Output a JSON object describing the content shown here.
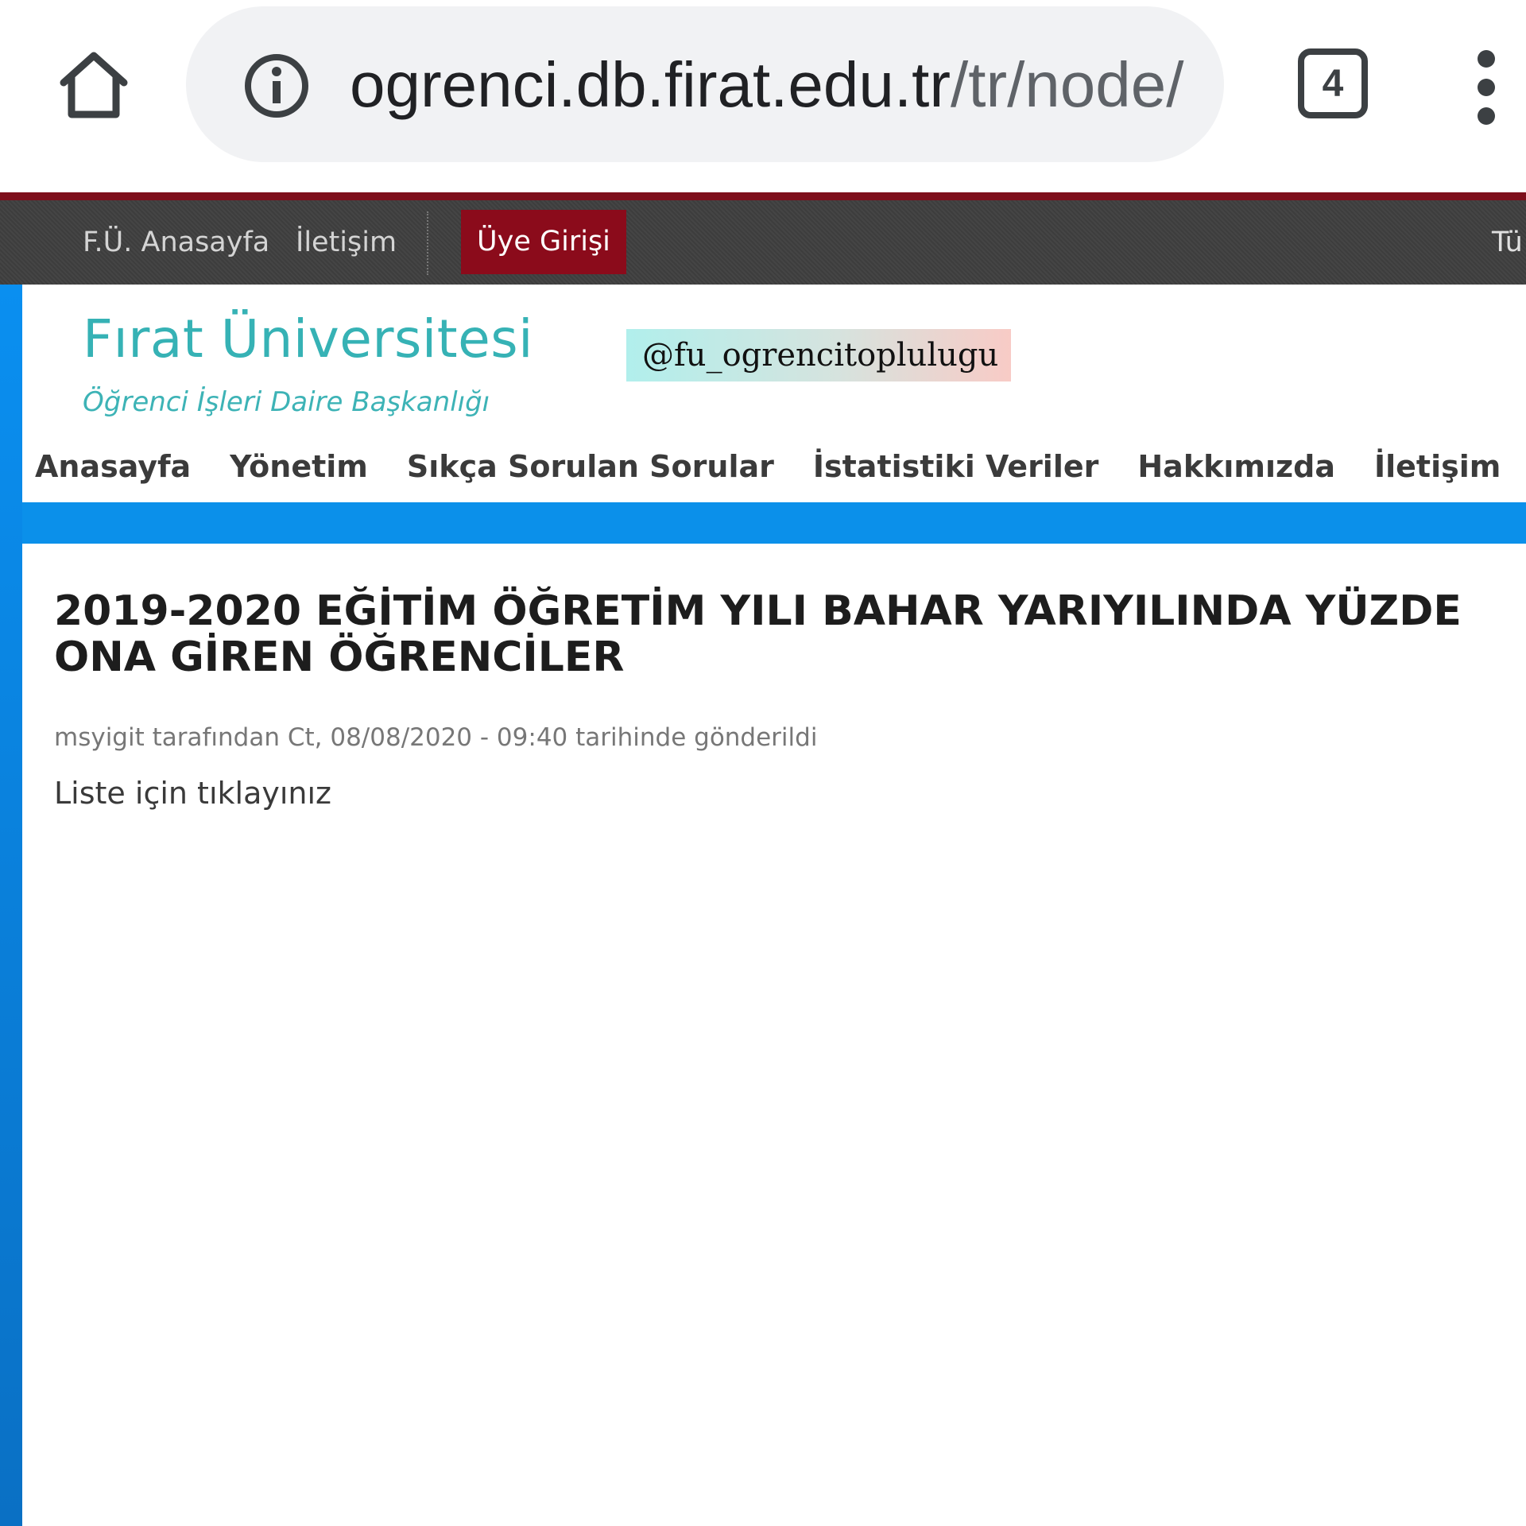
{
  "browser": {
    "url_host": "ogrenci.db.firat.edu.tr",
    "url_path": "/tr/node/",
    "tab_count": "4",
    "icons": {
      "home": "home-icon",
      "site_info": "info-icon",
      "tabs": "tab-switcher-icon",
      "menu": "more-vert-icon"
    }
  },
  "topbar": {
    "links": [
      "F.Ü. Anasayfa",
      "İletişim"
    ],
    "login_label": "Üye Girişi",
    "language_partial": "Tü"
  },
  "header": {
    "title": "Fırat Üniversitesi",
    "subtitle": "Öğrenci İşleri Daire Başkanlığı",
    "watermark": "@fu_ogrencitoplulugu"
  },
  "nav": {
    "items": [
      "Anasayfa",
      "Yönetim",
      "Sıkça Sorulan Sorular",
      "İstatistiki Veriler",
      "Hakkımızda",
      "İletişim"
    ]
  },
  "article": {
    "title": "2019-2020 EĞİTİM ÖĞRETİM YILI BAHAR YARIYILINDA YÜZDE ONA GİREN ÖĞRENCİLER",
    "meta": "msyigit tarafından Ct, 08/08/2020 - 09:40 tarihinde gönderildi",
    "body_link": "Liste için tıklayınız"
  },
  "colors": {
    "brand_red": "#8b0b1b",
    "teal_title": "#36b2b5",
    "accent_blue": "#0b90ea",
    "topbar_bg": "#3f3f3f"
  }
}
